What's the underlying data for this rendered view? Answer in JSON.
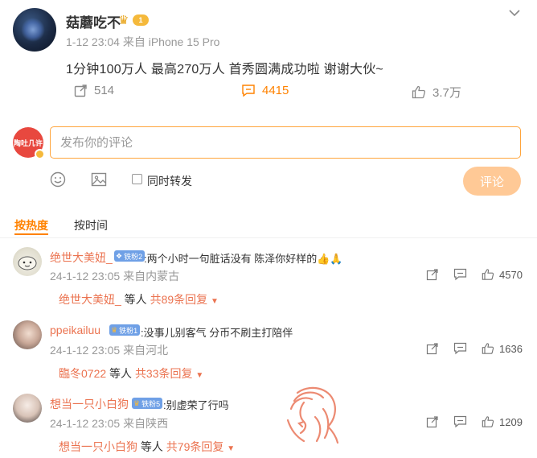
{
  "post": {
    "author": "菇蘑吃不",
    "vip_level": "1",
    "time": "1-12 23:04",
    "source": "来自 iPhone 15 Pro",
    "text": "1分钟100万人 最高270万人 首秀圆满成功啦 谢谢大伙~",
    "repost_count": "514",
    "comment_count": "4415",
    "like_count": "3.7万",
    "colors": {
      "accent": "#ff8200",
      "name": "#eb7350"
    }
  },
  "compose": {
    "avatar_text": "陶吐几许",
    "placeholder": "发布你的评论",
    "repost_label": "同时转发",
    "submit_label": "评论"
  },
  "sort_tabs": {
    "hot": "按热度",
    "time": "按时间"
  },
  "comments": [
    {
      "name": "绝世大美妞_",
      "badge": "铁粉2",
      "text": ":两个小时一句脏话没有 陈泽你好样的👍🙏",
      "time": "24-1-12 23:05",
      "location": "来自内蒙古",
      "likes": "4570",
      "reply_name": "绝世大美妞_",
      "reply_mid": " 等人 ",
      "reply_count": "共89条回复"
    },
    {
      "name": "ppeikailuu",
      "badge": "铁粉1",
      "text": ":没事儿别客气 分币不刷主打陪伴",
      "time": "24-1-12 23:05",
      "location": "来自河北",
      "likes": "1636",
      "reply_name": "臨冬0722",
      "reply_mid": " 等人 ",
      "reply_count": "共33条回复"
    },
    {
      "name": "想当一只小白狗",
      "badge": "铁粉5",
      "text": ":别虚荣了行吗",
      "time": "24-1-12 23:05",
      "location": "来自陕西",
      "likes": "1209",
      "reply_name": "想当一只小白狗",
      "reply_mid": " 等人 ",
      "reply_count": "共79条回复"
    }
  ]
}
